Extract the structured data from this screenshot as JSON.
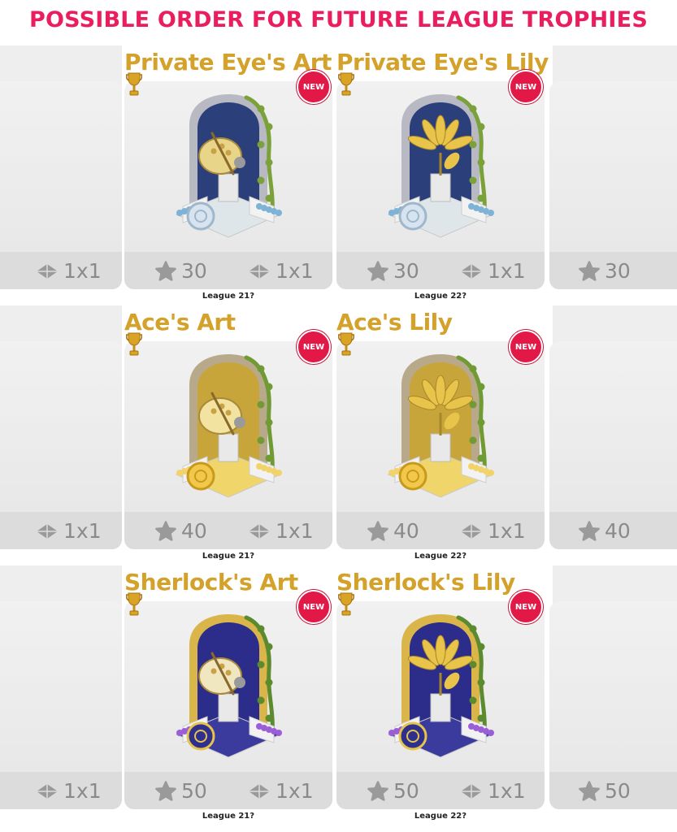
{
  "header": {
    "title": "POSSIBLE ORDER FOR FUTURE LEAGUE TROPHIES"
  },
  "badge_label": "NEW",
  "size_label": "1x1",
  "colors": {
    "title_red": "#ea1e5e",
    "gold": "#d4a12a",
    "badge_red": "#e21846",
    "stat_gray": "#8a8a8a"
  },
  "rows": [
    {
      "tier": "Private Eye",
      "score": "30",
      "cards": [
        {
          "title": "Private Eye's Art",
          "league": "League 21?",
          "icon": "palette-trophy-icon"
        },
        {
          "title": "Private Eye's Lily",
          "league": "League 22?",
          "icon": "lily-trophy-icon"
        }
      ]
    },
    {
      "tier": "Ace",
      "score": "40",
      "cards": [
        {
          "title": "Ace's Art",
          "league": "League 21?",
          "icon": "palette-trophy-icon"
        },
        {
          "title": "Ace's Lily",
          "league": "League 22?",
          "icon": "lily-trophy-icon"
        }
      ]
    },
    {
      "tier": "Sherlock",
      "score": "50",
      "cards": [
        {
          "title": "Sherlock's Art",
          "league": "League 21?",
          "icon": "palette-trophy-icon"
        },
        {
          "title": "Sherlock's Lily",
          "league": "League 22?",
          "icon": "lily-trophy-icon"
        }
      ]
    }
  ]
}
